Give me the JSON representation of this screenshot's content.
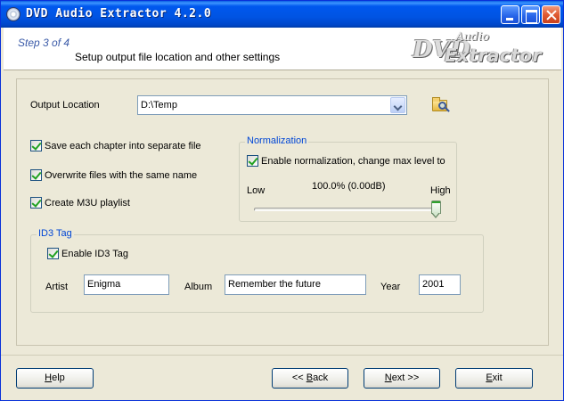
{
  "window": {
    "title": "DVD Audio Extractor 4.2.0"
  },
  "header": {
    "step": "Step 3 of 4",
    "description": "Setup output file location and other settings",
    "logo": {
      "line1": "DVD",
      "line2": "Audio",
      "line3": "Extractor"
    }
  },
  "output": {
    "label": "Output Location",
    "value": "D:\\Temp"
  },
  "options": {
    "save_each_chapter": {
      "label": "Save each chapter into separate file",
      "checked": true
    },
    "overwrite": {
      "label": "Overwrite files with the same name",
      "checked": true
    },
    "m3u": {
      "label": "Create M3U playlist",
      "checked": true
    }
  },
  "normalization": {
    "title": "Normalization",
    "enable": {
      "label": "Enable normalization, change max level to",
      "checked": true
    },
    "low_label": "Low",
    "high_label": "High",
    "level_text": "100.0% (0.00dB)",
    "level_fraction": 1.0
  },
  "id3": {
    "title": "ID3 Tag",
    "enable": {
      "label": "Enable ID3 Tag",
      "checked": true
    },
    "artist_label": "Artist",
    "artist_value": "Enigma",
    "album_label": "Album",
    "album_value": "Remember the future",
    "year_label": "Year",
    "year_value": "2001"
  },
  "footer": {
    "help": {
      "first": "H",
      "rest": "elp"
    },
    "back": {
      "pre": "<< ",
      "ul": "B",
      "rest": "ack"
    },
    "next": {
      "ul": "N",
      "rest": "ext >>"
    },
    "exit": {
      "ul": "E",
      "rest": "xit"
    }
  }
}
